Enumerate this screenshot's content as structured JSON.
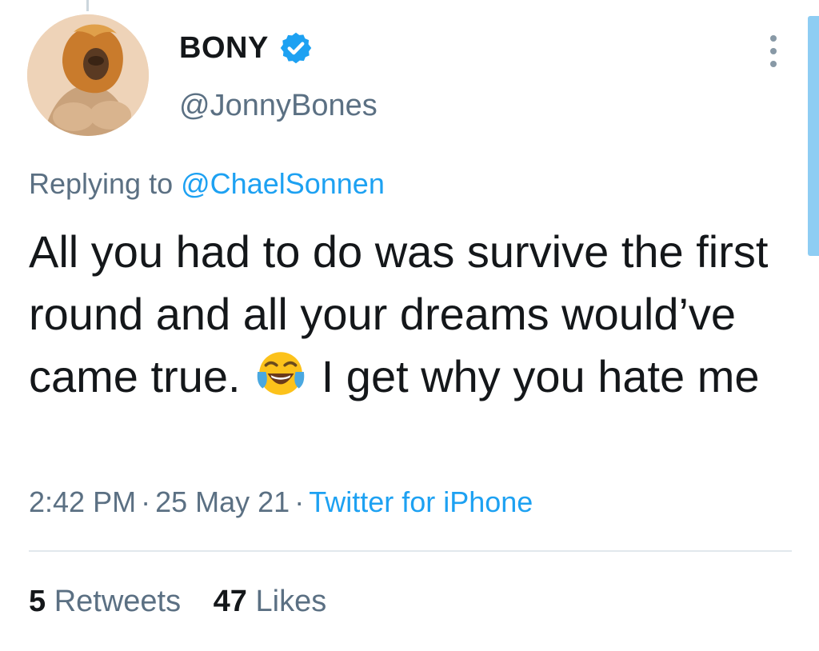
{
  "tweet": {
    "display_name": "BONY",
    "handle": "@JonnyBones",
    "verified": true,
    "replying_prefix": "Replying to",
    "replying_to": "@ChaelSonnen",
    "text_part1": "All you had to do was survive the first round and all your dreams would’ve came true.",
    "emoji": "face-with-tears-of-joy",
    "text_part2": "I get why you hate me",
    "time": "2:42 PM",
    "date": "25 May 21",
    "source": "Twitter for iPhone",
    "separator": "·",
    "retweets_count": "5",
    "retweets_label": "Retweets",
    "likes_count": "47",
    "likes_label": "Likes"
  },
  "colors": {
    "link_blue": "#1da1f2",
    "secondary_text": "#5b7083",
    "primary_text": "#14171a"
  },
  "icons": {
    "verified": "verified-badge-icon",
    "more": "more-options-icon"
  }
}
